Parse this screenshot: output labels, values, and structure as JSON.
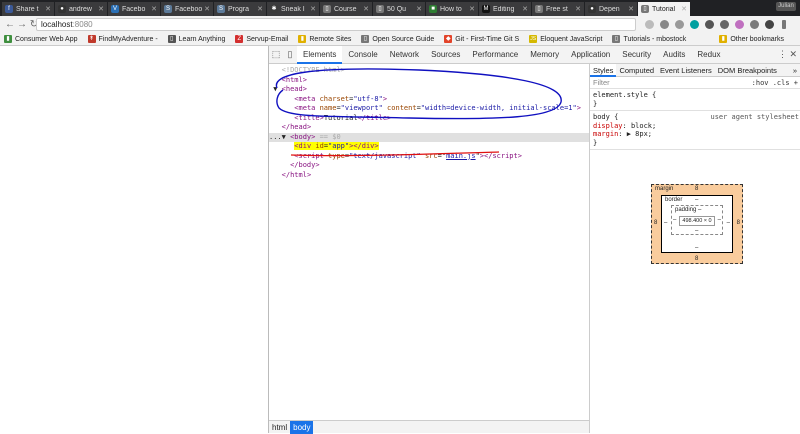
{
  "tabs": [
    {
      "title": "Share t",
      "icon": "facebook-icon",
      "color": "#3b5998",
      "glyph": "f"
    },
    {
      "title": "andrew",
      "icon": "github-icon",
      "color": "#333333",
      "glyph": "●"
    },
    {
      "title": "Facebo",
      "icon": "vue-icon",
      "color": "#2a6fb5",
      "glyph": "V"
    },
    {
      "title": "Faceboo",
      "icon": "sitepoint-icon",
      "color": "#5c7a99",
      "glyph": "S"
    },
    {
      "title": "Progra",
      "icon": "sitepoint-icon",
      "color": "#5c7a99",
      "glyph": "S"
    },
    {
      "title": "Sneak I",
      "icon": "react-icon",
      "color": "#3a3a3a",
      "glyph": "✱"
    },
    {
      "title": "Course",
      "icon": "page-icon",
      "color": "#777777",
      "glyph": "▯"
    },
    {
      "title": "50 Qu",
      "icon": "page-icon",
      "color": "#777777",
      "glyph": "▯"
    },
    {
      "title": "How to",
      "icon": "green-page-icon",
      "color": "#2e7d32",
      "glyph": "■"
    },
    {
      "title": "Editing",
      "icon": "medium-icon",
      "color": "#111111",
      "glyph": "M"
    },
    {
      "title": "Free st",
      "icon": "page-icon",
      "color": "#777777",
      "glyph": "▯"
    },
    {
      "title": "Depen",
      "icon": "github-icon",
      "color": "#333333",
      "glyph": "●"
    },
    {
      "title": "Tutorial",
      "icon": "page-icon",
      "color": "#777777",
      "glyph": "▯",
      "active": true
    }
  ],
  "user_chip": "Julian",
  "address": {
    "host": "localhost",
    "port": ":8080"
  },
  "bookmarks": [
    {
      "label": "Consumer Web App",
      "icon": "folder-icon",
      "color": "#3f8f3f",
      "glyph": "▮"
    },
    {
      "label": "FindMyAdventure -",
      "icon": "bookmark-icon",
      "color": "#c0392b",
      "glyph": "↟"
    },
    {
      "label": "Learn Anything",
      "icon": "bookmark-icon",
      "color": "#555555",
      "glyph": "▯"
    },
    {
      "label": "Servup-Email",
      "icon": "zoho-icon",
      "color": "#d32f2f",
      "glyph": "Z"
    },
    {
      "label": "Remote Sites",
      "icon": "folder-icon",
      "color": "#e0b000",
      "glyph": "▮"
    },
    {
      "label": "Open Source Guide",
      "icon": "page-icon",
      "color": "#777777",
      "glyph": "▯"
    },
    {
      "label": "Git - First-Time Git S",
      "icon": "git-icon",
      "color": "#e24329",
      "glyph": "◆"
    },
    {
      "label": "Eloquent JavaScript",
      "icon": "js-icon",
      "color": "#d4b800",
      "glyph": "JS"
    },
    {
      "label": "Tutorials - mbostock",
      "icon": "page-icon",
      "color": "#777777",
      "glyph": "▯"
    },
    {
      "label": "Other bookmarks",
      "icon": "folder-icon",
      "color": "#e0b000",
      "glyph": "▮",
      "other": true
    }
  ],
  "devtools": {
    "tabs": [
      "Elements",
      "Console",
      "Network",
      "Sources",
      "Performance",
      "Memory",
      "Application",
      "Security",
      "Audits",
      "Redux"
    ],
    "active_tab": "Elements",
    "code": {
      "doctype": "<!DOCTYPE html>",
      "html_open": "<html>",
      "head_open": "<head>",
      "meta1_tag": "meta",
      "meta1_attr": "charset",
      "meta1_val": "\"utf-8\"",
      "meta2_tag": "meta",
      "meta2_attr1": "name",
      "meta2_val1": "\"viewport\"",
      "meta2_attr2": "content",
      "meta2_val2": "\"width=device-width, initial-scale=1\"",
      "title_text": "Tutorial",
      "head_close": "</head>",
      "body_open": "<body>",
      "body_marker": "== $0",
      "div_attr": "id",
      "div_val": "\"app\"",
      "script_attr1": "type",
      "script_val1": "\"text/javascript\"",
      "script_attr2": "src",
      "script_val2": "main.js",
      "body_close": "</body>",
      "html_close": "</html>"
    },
    "breadcrumbs": [
      "html",
      "body"
    ],
    "styles_tabs": [
      "Styles",
      "Computed",
      "Event Listeners",
      "DOM Breakpoints"
    ],
    "filter_placeholder": "Filter",
    "filter_right": ":hov  .cls  +",
    "rules": {
      "element_style": "element.style {",
      "close": "}",
      "body_selector": "body {",
      "body_source": "user agent stylesheet",
      "prop1_name": "display",
      "prop1_value": "block;",
      "prop2_name": "margin",
      "prop2_value": "▶ 8px;"
    },
    "box_model": {
      "margin_label": "margin",
      "margin": "8",
      "border_label": "border",
      "border": "–",
      "padding_label": "padding –",
      "content": "498.400 × 0",
      "dash": "–"
    }
  },
  "annotation_colors": {
    "head_circle": "#1010c0",
    "script_underline": "#e01010"
  }
}
